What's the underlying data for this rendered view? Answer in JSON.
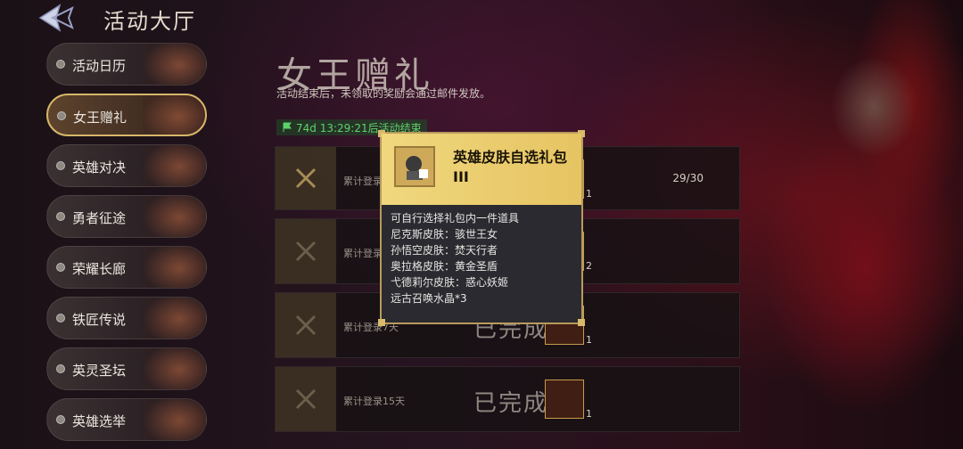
{
  "header": {
    "title": "活动大厅"
  },
  "sidebar": {
    "items": [
      {
        "label": "活动日历"
      },
      {
        "label": "女王赠礼",
        "active": true
      },
      {
        "label": "英雄对决"
      },
      {
        "label": "勇者征途"
      },
      {
        "label": "荣耀长廊"
      },
      {
        "label": "铁匠传说"
      },
      {
        "label": "英灵圣坛"
      },
      {
        "label": "英雄选举"
      }
    ]
  },
  "main": {
    "title": "女王赠礼",
    "subtitle": "活动结束后，未领取的奖励会通过邮件发放。",
    "timer": "74d 13:29:21后活动结束",
    "tasks": [
      {
        "label": "累计登录",
        "progress": "29/30",
        "reward_count": "1"
      },
      {
        "label": "累计登录",
        "progress": "",
        "reward_count": "2"
      },
      {
        "label": "累计登录7天",
        "status": "已完成",
        "reward_count": "1"
      },
      {
        "label": "累计登录15天",
        "status": "已完成",
        "reward_count": "1"
      }
    ]
  },
  "tooltip": {
    "item_name": "英雄皮肤自选礼包III",
    "item_count": "",
    "lines": [
      "可自行选择礼包内一件道具",
      "尼克斯皮肤：骇世王女",
      "孙悟空皮肤：焚天行者",
      "奥拉格皮肤：黄金圣盾",
      "弋德莉尔皮肤：惑心妖姬",
      "远古召唤水晶*3"
    ]
  },
  "colors": {
    "accent_gold": "#d7b66a",
    "timer_green": "#5fd16a"
  }
}
